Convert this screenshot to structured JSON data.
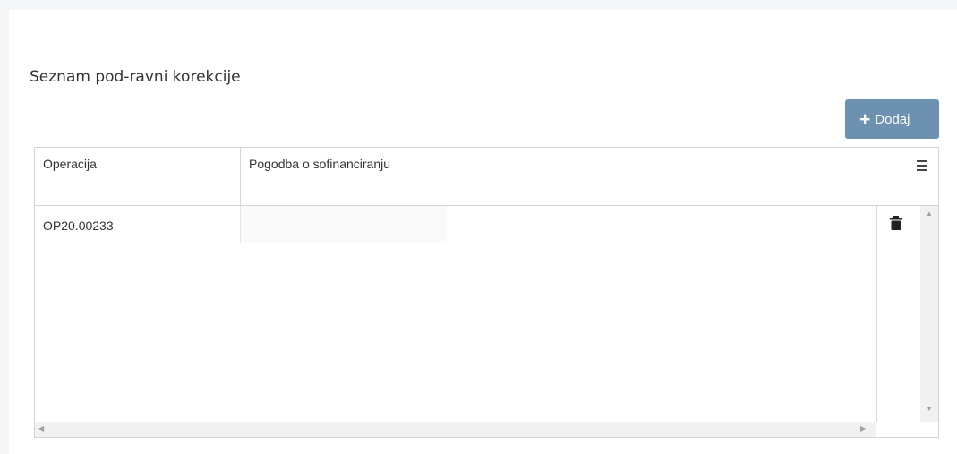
{
  "panel": {
    "title": "Seznam pod-ravni korekcije"
  },
  "toolbar": {
    "add_label": "Dodaj",
    "add_icon": "plus-icon"
  },
  "grid": {
    "columns": [
      "Operacija",
      "Pogodba o sofinanciranju"
    ],
    "rows": [
      {
        "operacija": "OP20.00233",
        "pogodba": ""
      }
    ]
  },
  "colors": {
    "accent": "#6d91b0",
    "border": "#d4d4d4",
    "text": "#333333"
  }
}
